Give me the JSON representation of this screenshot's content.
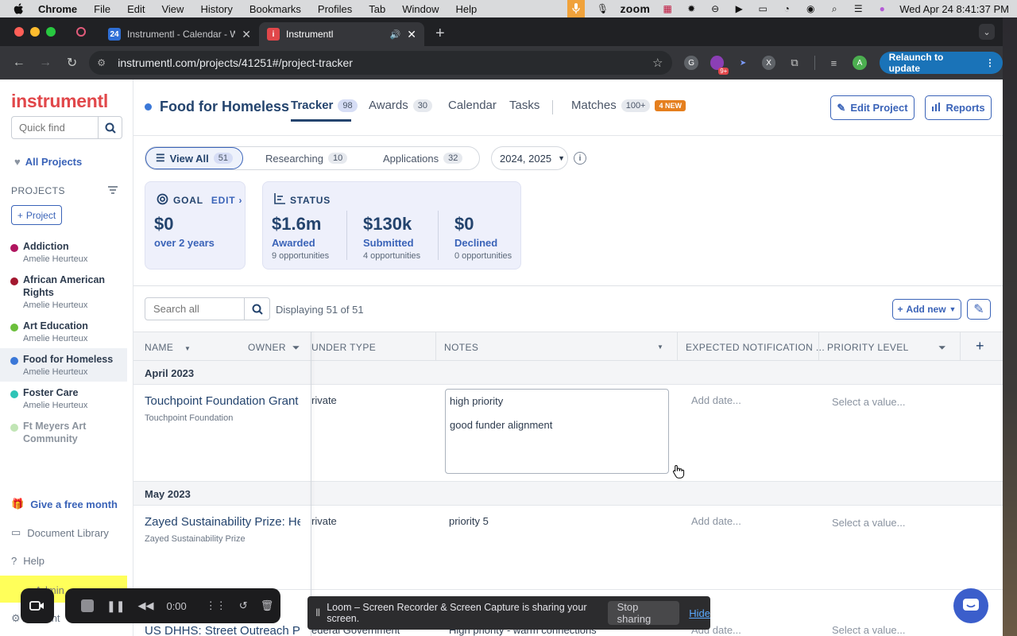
{
  "menubar": {
    "app": "Chrome",
    "items": [
      "File",
      "Edit",
      "View",
      "History",
      "Bookmarks",
      "Profiles",
      "Tab",
      "Window",
      "Help"
    ],
    "zoom": "zoom",
    "clock": "Wed Apr 24  8:41:37 PM"
  },
  "browser": {
    "tabs": [
      {
        "title": "Instrumentl - Calendar - Wee",
        "favicon": "calendar-icon"
      },
      {
        "title": "Instrumentl",
        "favicon": "instrumentl-icon"
      }
    ],
    "url": "instrumentl.com/projects/41251#/project-tracker",
    "relaunch": "Relaunch to update",
    "notif_badge": "9+",
    "avatar": "A"
  },
  "sidebar": {
    "logo": "instrumentl",
    "quickfind_placeholder": "Quick find",
    "all_projects": "All Projects",
    "projects_header": "PROJECTS",
    "add_project": "Project",
    "projects": [
      {
        "name": "Addiction",
        "owner": "Amelie Heurteux",
        "color": "#b0155f"
      },
      {
        "name": "African American Rights",
        "owner": "Amelie Heurteux",
        "color": "#a3182f"
      },
      {
        "name": "Art Education",
        "owner": "Amelie Heurteux",
        "color": "#6bbf3b"
      },
      {
        "name": "Food for Homeless",
        "owner": "Amelie Heurteux",
        "color": "#3b78d8"
      },
      {
        "name": "Foster Care",
        "owner": "Amelie Heurteux",
        "color": "#2ec4b6"
      },
      {
        "name": "Ft Meyers Art Community",
        "owner": "",
        "color": "#8fd07a"
      }
    ],
    "give_free_month": "Give a free month",
    "document_library": "Document Library",
    "help": "Help",
    "admin": "Admin",
    "account": "Account"
  },
  "header": {
    "project_title": "Food for Homeless",
    "nav": [
      {
        "label": "Tracker",
        "count": "98"
      },
      {
        "label": "Awards",
        "count": "30"
      },
      {
        "label": "Calendar",
        "count": ""
      },
      {
        "label": "Tasks",
        "count": ""
      },
      {
        "label": "Matches",
        "count": "100+",
        "badge": "4 NEW"
      }
    ],
    "edit_project": "Edit Project",
    "reports": "Reports"
  },
  "filters": {
    "segments": [
      {
        "label": "View All",
        "count": "51"
      },
      {
        "label": "Researching",
        "count": "10"
      },
      {
        "label": "Applications",
        "count": "32"
      }
    ],
    "years": "2024, 2025",
    "info": "i"
  },
  "goal": {
    "label": "GOAL",
    "edit": "EDIT",
    "value": "$0",
    "sub": "over 2 years"
  },
  "status": {
    "label": "STATUS",
    "items": [
      {
        "value": "$1.6m",
        "label": "Awarded",
        "sub": "9 opportunities"
      },
      {
        "value": "$130k",
        "label": "Submitted",
        "sub": "4 opportunities"
      },
      {
        "value": "$0",
        "label": "Declined",
        "sub": "0 opportunities"
      }
    ]
  },
  "table": {
    "search_placeholder": "Search all",
    "displaying": "Displaying 51 of 51",
    "add_new": "Add new",
    "columns": {
      "name": "NAME",
      "owner": "OWNER",
      "funder_type": "UNDER TYPE",
      "notes": "NOTES",
      "expected": "EXPECTED NOTIFICATION ...",
      "priority": "PRIORITY LEVEL"
    },
    "groups": [
      {
        "label": "April 2023",
        "rows": [
          {
            "name": "Touchpoint Foundation Grant",
            "org": "Touchpoint Foundation",
            "funder": "rivate",
            "notes1": "high priority",
            "notes2": "good funder alignment",
            "date": "Add date...",
            "priority": "Select a value..."
          }
        ]
      },
      {
        "label": "May 2023",
        "rows": [
          {
            "name": "Zayed Sustainability Prize: He...",
            "org": "Zayed Sustainability Prize",
            "funder": "rivate",
            "notes1": "priority 5",
            "notes2": "",
            "date": "Add date...",
            "priority": "Select a value..."
          },
          {
            "name": "US DHHS: Street Outreach Pr...",
            "org": "",
            "funder": "ederal Government",
            "notes1": "High priority - warm connections",
            "notes2": "",
            "date": "Add date...",
            "priority": "Select a value..."
          }
        ]
      }
    ]
  },
  "loom": {
    "timer": "0:00",
    "share_text": "Loom – Screen Recorder & Screen Capture is sharing your screen.",
    "stop_sharing": "Stop sharing",
    "hide": "Hide"
  }
}
